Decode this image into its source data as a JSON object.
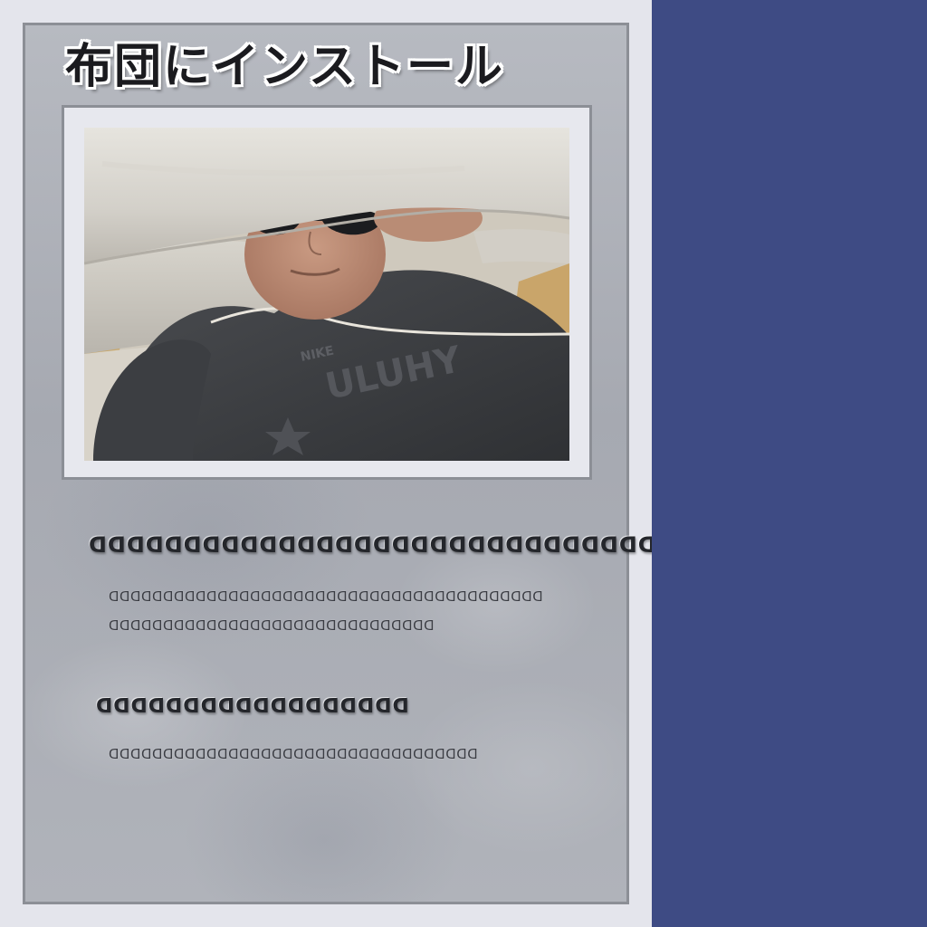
{
  "card": {
    "title": "布団にインストール"
  },
  "photo": {
    "icon": "photo-person-under-futon"
  },
  "section_1": {
    "heading": "ꓷꓷꓷꓷꓷꓷꓷꓷꓷꓷꓷꓷꓷꓷꓷꓷꓷꓷꓷꓷꓷꓷꓷꓷꓷꓷꓷꓷꓷꓷ",
    "lines": [
      "ꓷꓷꓷꓷꓷꓷꓷꓷꓷꓷꓷꓷꓷꓷꓷꓷꓷꓷꓷꓷꓷꓷꓷꓷꓷꓷꓷꓷꓷꓷꓷꓷꓷꓷꓷꓷꓷꓷꓷꓷ",
      "ꓷꓷꓷꓷꓷꓷꓷꓷꓷꓷꓷꓷꓷꓷꓷꓷꓷꓷꓷꓷꓷꓷꓷꓷꓷꓷꓷꓷꓷꓷ"
    ]
  },
  "section_2": {
    "heading": "ꓷꓷꓷꓷꓷꓷꓷꓷꓷꓷꓷꓷꓷꓷꓷꓷꓷꓷ",
    "lines": [
      "ꓷꓷꓷꓷꓷꓷꓷꓷꓷꓷꓷꓷꓷꓷꓷꓷꓷꓷꓷꓷꓷꓷꓷꓷꓷꓷꓷꓷꓷꓷꓷꓷꓷꓷ"
    ]
  },
  "colors": {
    "sidebar": "#3e4b84",
    "background": "#e4e5ec",
    "card": "#aeb1b8",
    "frame_border": "#8c8f96"
  }
}
